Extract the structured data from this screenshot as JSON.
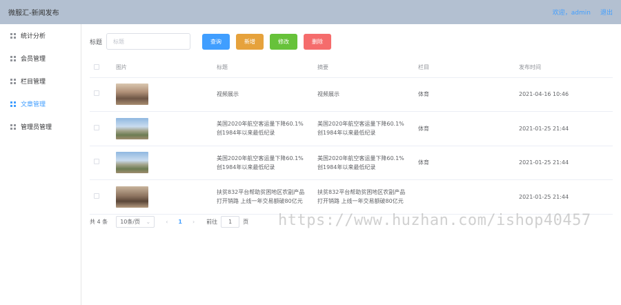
{
  "header": {
    "title": "微服汇-新闻发布",
    "welcome": "欢迎，admin",
    "logout": "退出"
  },
  "sidebar": {
    "items": [
      {
        "label": "统计分析",
        "active": false
      },
      {
        "label": "会员管理",
        "active": false
      },
      {
        "label": "栏目管理",
        "active": false
      },
      {
        "label": "文章管理",
        "active": true
      },
      {
        "label": "管理员管理",
        "active": false
      }
    ]
  },
  "search": {
    "label": "标题",
    "placeholder": "标题"
  },
  "buttons": {
    "query": "查询",
    "add": "新增",
    "edit": "修改",
    "delete": "删除"
  },
  "table": {
    "headers": {
      "image": "图片",
      "title": "标题",
      "summary": "摘要",
      "column": "栏目",
      "time": "发布时间"
    },
    "rows": [
      {
        "title_l1": "视频展示",
        "title_l2": "",
        "summary_l1": "视频展示",
        "summary_l2": "",
        "column": "体育",
        "time": "2021-04-16 10:46"
      },
      {
        "title_l1": "美国2020年航空客运量下降60.1%",
        "title_l2": "创1984年以来最低纪录",
        "summary_l1": "美国2020年航空客运量下降60.1%",
        "summary_l2": "创1984年以来最低纪录",
        "column": "体育",
        "time": "2021-01-25 21:44"
      },
      {
        "title_l1": "美国2020年航空客运量下降60.1%",
        "title_l2": "创1984年以来最低纪录",
        "summary_l1": "美国2020年航空客运量下降60.1%",
        "summary_l2": "创1984年以来最低纪录",
        "column": "体育",
        "time": "2021-01-25 21:44"
      },
      {
        "title_l1": "扶贫832平台帮助贫困地区农副产品",
        "title_l2": "打开销路 上线一年交易额破80亿元",
        "summary_l1": "扶贫832平台帮助贫困地区农副产品",
        "summary_l2": "打开销路 上线一年交易额破80亿元",
        "column": "",
        "time": "2021-01-25 21:44"
      }
    ]
  },
  "pagination": {
    "total": "共 4 条",
    "page_size": "10条/页",
    "prev": "‹",
    "current": "1",
    "next": "›",
    "goto": "前往",
    "goto_value": "1",
    "page_unit": "页"
  },
  "watermark": "https://www.huzhan.com/ishop40457",
  "colors": {
    "header_bg": "#b3c0d1",
    "accent": "#409eff",
    "warning": "#e6a23c",
    "success": "#67c23a",
    "danger": "#f56c6c"
  }
}
